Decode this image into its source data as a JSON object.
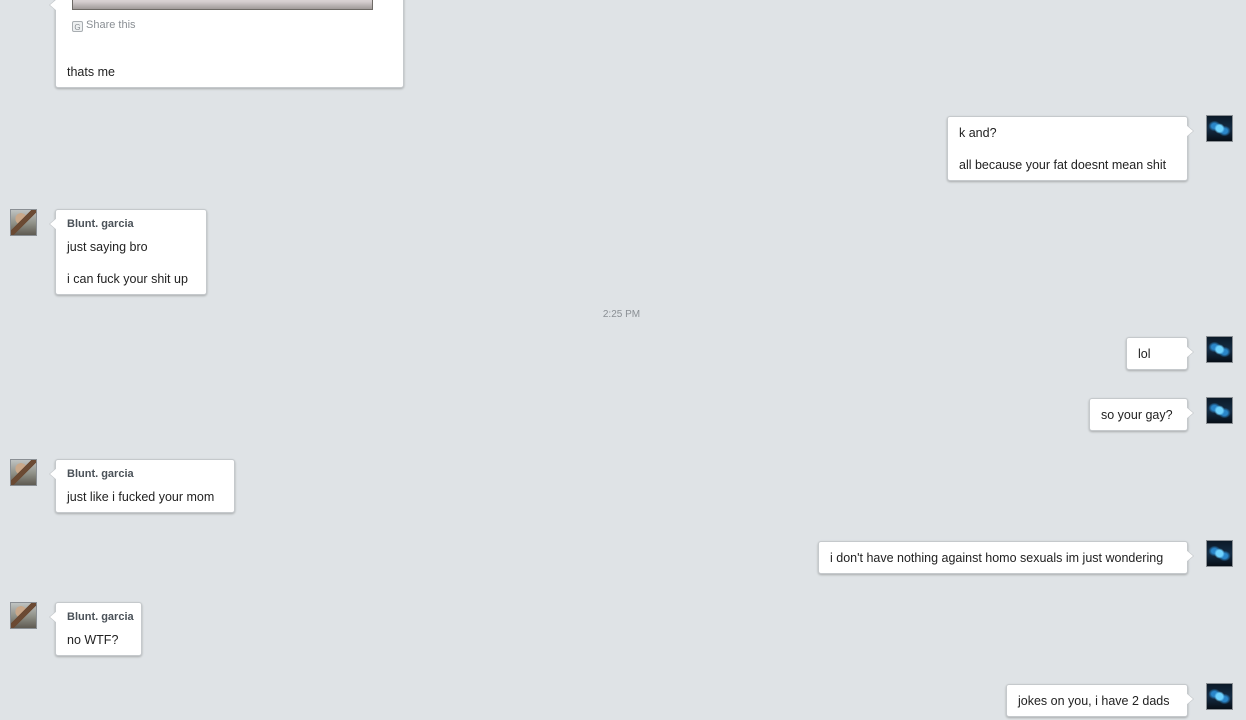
{
  "first_message": {
    "share_label": "Share this",
    "lines": [
      "thats me"
    ]
  },
  "timestamp": "2:25 PM",
  "messages": [
    {
      "side": "right",
      "lines": [
        "k and?",
        "all because your fat doesnt mean shit"
      ]
    },
    {
      "side": "left",
      "sender": "Blunt. garcia",
      "lines": [
        "just saying bro",
        "i can fuck your shit up"
      ]
    },
    {
      "side": "right",
      "lines": [
        "lol"
      ]
    },
    {
      "side": "right",
      "lines": [
        "so your gay?"
      ]
    },
    {
      "side": "left",
      "sender": "Blunt. garcia",
      "lines": [
        "just like i fucked your mom"
      ]
    },
    {
      "side": "right",
      "lines": [
        "i don't have nothing against homo sexuals im just wondering"
      ]
    },
    {
      "side": "left",
      "sender": "Blunt. garcia",
      "lines": [
        "no WTF?"
      ]
    },
    {
      "side": "right",
      "lines": [
        "jokes on you, i have 2 dads"
      ]
    }
  ]
}
